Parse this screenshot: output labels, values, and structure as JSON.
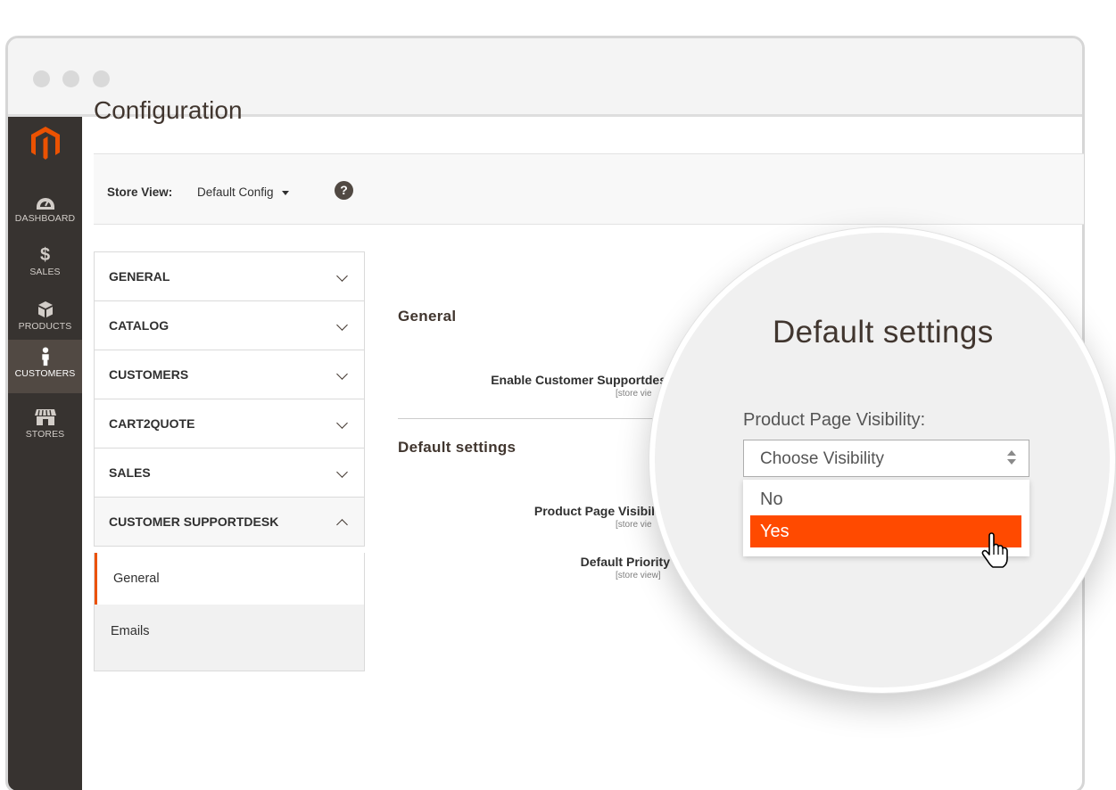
{
  "browser": {
    "dots": [
      "window-dot-1",
      "window-dot-2",
      "window-dot-3"
    ]
  },
  "admin_nav": {
    "logo": "magento-logo-icon",
    "items": [
      {
        "label": "DASHBOARD",
        "icon": "dashboard-gauge-icon",
        "active": false
      },
      {
        "label": "SALES",
        "icon": "dollar-icon",
        "active": false
      },
      {
        "label": "PRODUCTS",
        "icon": "box-icon",
        "active": false
      },
      {
        "label": "CUSTOMERS",
        "icon": "person-icon",
        "active": true
      },
      {
        "label": "STORES",
        "icon": "storefront-icon",
        "active": false
      }
    ]
  },
  "page": {
    "title": "Configuration"
  },
  "store_view": {
    "label": "Store View:",
    "value": "Default Config",
    "help": "?"
  },
  "config_tabs": [
    {
      "label": "GENERAL",
      "expanded": false
    },
    {
      "label": "CATALOG",
      "expanded": false
    },
    {
      "label": "CUSTOMERS",
      "expanded": false
    },
    {
      "label": "CART2QUOTE",
      "expanded": false
    },
    {
      "label": "SALES",
      "expanded": false
    },
    {
      "label": "CUSTOMER SUPPORTDESK",
      "expanded": true
    }
  ],
  "subtabs": [
    {
      "label": "General",
      "current": true
    },
    {
      "label": "Emails",
      "current": false
    }
  ],
  "sections": {
    "general": {
      "title": "General",
      "fields": [
        {
          "label": "Enable Customer Supportdes",
          "scope": "[store vie"
        }
      ]
    },
    "default_settings": {
      "title": "Default settings",
      "fields": [
        {
          "label": "Product Page Visibil",
          "scope": "[store vie"
        },
        {
          "label": "Default Priority",
          "scope": "[store view]"
        }
      ]
    }
  },
  "magnifier": {
    "title": "Default settings",
    "field_label": "Product Page Visibility:",
    "select_value": "Choose Visibility",
    "options": [
      {
        "label": "No",
        "highlighted": false
      },
      {
        "label": "Yes",
        "highlighted": true
      }
    ],
    "accent_color": "#ff4a00"
  },
  "colors": {
    "admin_nav_bg": "#373330",
    "admin_nav_active": "#514943",
    "tab_active_border": "#eb5202"
  }
}
